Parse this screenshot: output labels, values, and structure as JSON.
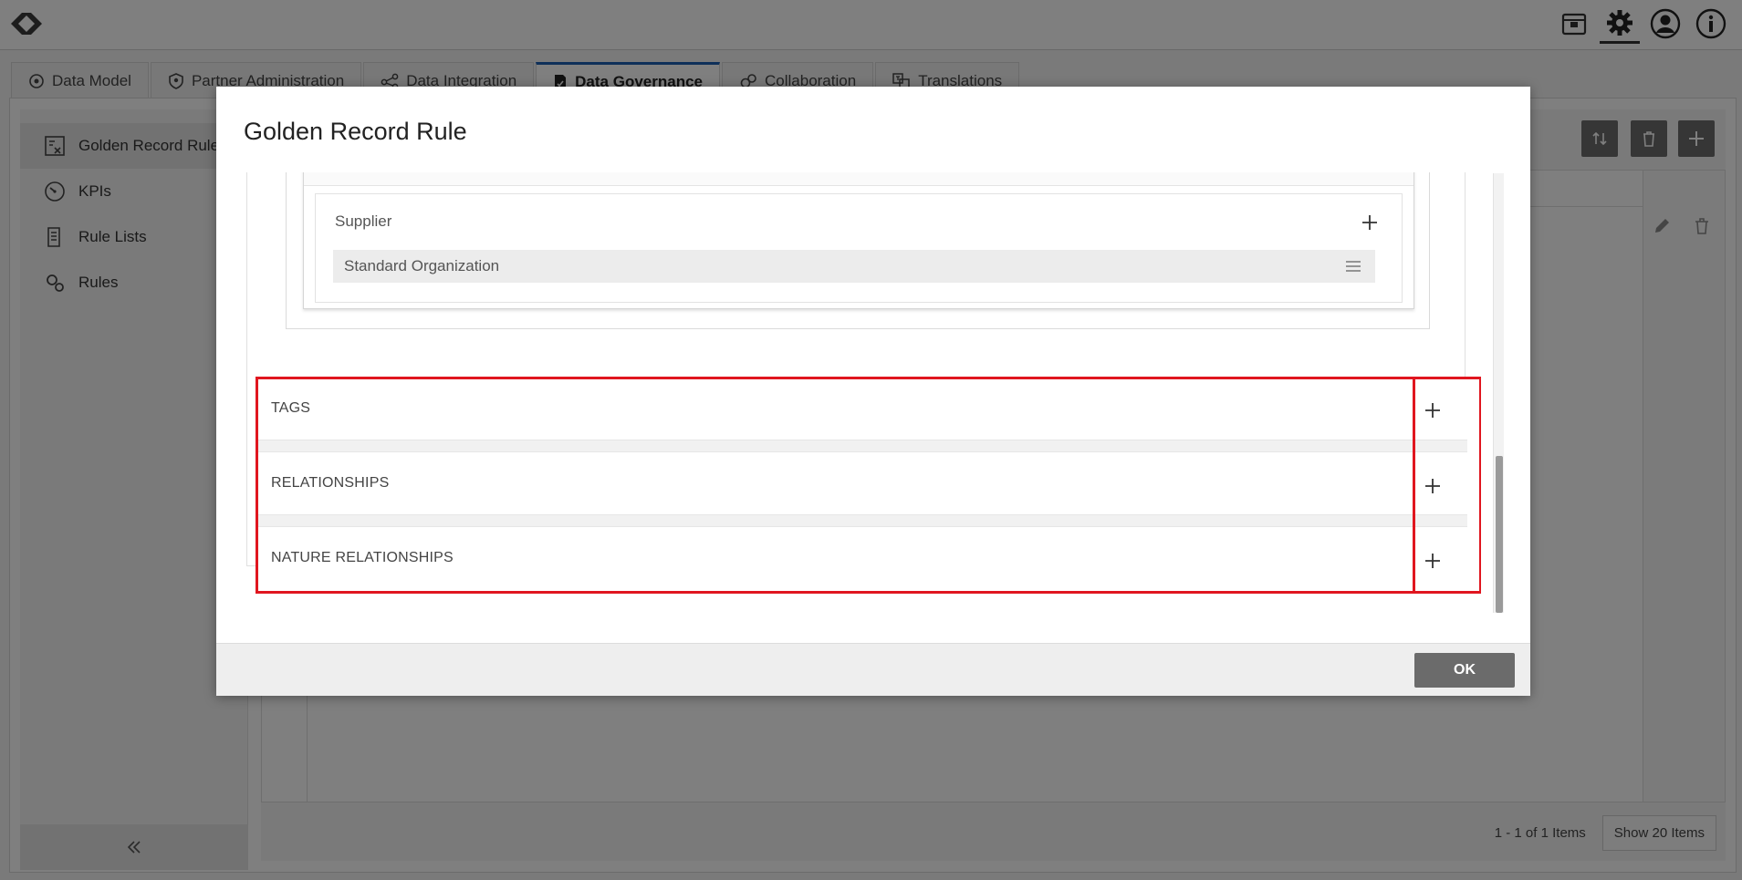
{
  "app": {
    "tabs": [
      {
        "label": "Data Model",
        "icon": "data-model-icon"
      },
      {
        "label": "Partner Administration",
        "icon": "shield-icon"
      },
      {
        "label": "Data Integration",
        "icon": "integration-icon"
      },
      {
        "label": "Data Governance",
        "icon": "governance-icon"
      },
      {
        "label": "Collaboration",
        "icon": "collaboration-icon"
      },
      {
        "label": "Translations",
        "icon": "translations-icon"
      }
    ],
    "active_tab": "Data Governance",
    "sidebar": {
      "items": [
        {
          "label": "Golden Record Rules",
          "icon": "golden-record-icon"
        },
        {
          "label": "KPIs",
          "icon": "gauge-icon"
        },
        {
          "label": "Rule Lists",
          "icon": "rule-list-icon"
        },
        {
          "label": "Rules",
          "icon": "rules-gear-icon"
        }
      ]
    },
    "pager": {
      "summary": "1 - 1 of 1 Items",
      "page_size": "Show 20 Items"
    },
    "accent_color": "#1c5fb3"
  },
  "modal": {
    "title": "Golden Record Rule",
    "supplier": {
      "label": "Supplier",
      "item": "Standard Organization"
    },
    "sections": [
      {
        "label": "TAGS"
      },
      {
        "label": "RELATIONSHIPS"
      },
      {
        "label": "NATURE RELATIONSHIPS"
      }
    ],
    "ok_label": "OK",
    "highlight_color": "#e0161f"
  }
}
